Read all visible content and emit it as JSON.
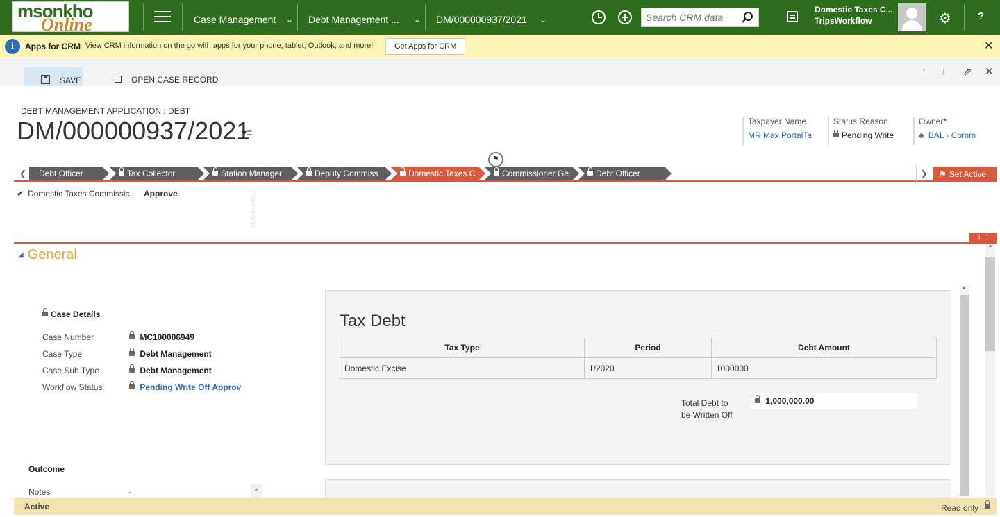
{
  "app": {
    "logo_line1": "msonkho",
    "logo_line2": "Online",
    "nav": [
      "Case Management",
      "Debt Management ...",
      "DM/000000937/2021"
    ],
    "search_placeholder": "Search CRM data",
    "user_org": "Domestic Taxes C...",
    "user_workflow": "TripsWorkflow",
    "help": "?"
  },
  "notice": {
    "title": "Apps for CRM",
    "message": "View CRM information on the go with apps for your phone, tablet, Outlook, and more!",
    "button": "Get Apps for CRM"
  },
  "commands": {
    "save": "SAVE",
    "open_case": "OPEN CASE RECORD"
  },
  "header": {
    "entity": "DEBT MANAGEMENT APPLICATION : DEBT",
    "record": "DM/000000937/2021",
    "fields": [
      {
        "label": "Taxpayer Name",
        "value": "MR Max PortalTa"
      },
      {
        "label": "Status Reason",
        "value": "Pending Write"
      },
      {
        "label": "Owner",
        "value": "BAL - Comm"
      }
    ]
  },
  "process": {
    "stages": [
      {
        "label": "Debt Officer",
        "locked": false,
        "active": false
      },
      {
        "label": "Tax Collector",
        "locked": true,
        "active": false
      },
      {
        "label": "Station Manager",
        "locked": true,
        "active": false
      },
      {
        "label": "Deputy Commiss",
        "locked": true,
        "active": false
      },
      {
        "label": "Domestic Taxes C",
        "locked": true,
        "active": true
      },
      {
        "label": "Commissioner Ge",
        "locked": true,
        "active": false
      },
      {
        "label": "Debt Officer",
        "locked": true,
        "active": false
      }
    ],
    "set_active": "Set Active",
    "step_label": "Domestic Taxes Commissic",
    "step_value": "Approve"
  },
  "general": {
    "title": "General",
    "case_details": "Case Details",
    "rows": [
      {
        "label": "Case Number",
        "value": "MC100006949"
      },
      {
        "label": "Case Type",
        "value": "Debt Management"
      },
      {
        "label": "Case Sub Type",
        "value": "Debt Management"
      },
      {
        "label": "Workflow Status",
        "value": "Pending Write Off Approv"
      }
    ],
    "outcome": "Outcome",
    "notes_label": "Notes",
    "notes_value": "--"
  },
  "tax_debt": {
    "title": "Tax Debt",
    "columns": [
      "Tax Type",
      "Period",
      "Debt Amount"
    ],
    "rows": [
      [
        "Domestic Excise",
        "1/2020",
        "1000000"
      ]
    ],
    "total_label": "Total Debt to be Written Off",
    "total_value": "1,000,000.00"
  },
  "status": {
    "state": "Active",
    "mode": "Read only"
  },
  "colors": {
    "nav_green": "#2e6d1e",
    "accent_orange": "#d9593e",
    "link_blue": "#2b6bb3"
  }
}
